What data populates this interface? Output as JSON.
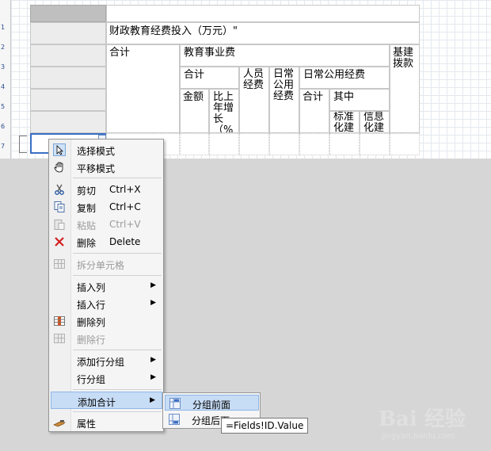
{
  "ruler": {
    "numbers": [
      "1",
      "2",
      "3",
      "4",
      "5",
      "6",
      "7"
    ]
  },
  "table": {
    "title": "财政教育经费投入（万元）\"",
    "col_total": "合计",
    "edu_business": "教育事业费",
    "sub_total": "合计",
    "staff_funds": "人员经费",
    "daily_public": "日常公用经费",
    "daily_public_funds": "日常公用经费",
    "capital": "基建拨款",
    "amount": "金额",
    "growth": "比上年增长（%",
    "dp_total": "合计",
    "among": "其中",
    "standardize": "标准化建",
    "info": "信息化建"
  },
  "context_menu": {
    "items": [
      {
        "icon": "pointer-icon",
        "label": "选择模式",
        "shortcut": "",
        "enabled": true
      },
      {
        "icon": "hand-icon",
        "label": "平移模式",
        "shortcut": "",
        "enabled": true
      },
      {
        "icon": "scissors-icon",
        "label": "剪切",
        "shortcut": "Ctrl+X",
        "enabled": true
      },
      {
        "icon": "copy-icon",
        "label": "复制",
        "shortcut": "Ctrl+C",
        "enabled": true
      },
      {
        "icon": "paste-icon",
        "label": "粘贴",
        "shortcut": "Ctrl+V",
        "enabled": false
      },
      {
        "icon": "delete-icon",
        "label": "删除",
        "shortcut": "Delete",
        "enabled": true
      },
      {
        "icon": "split-cells-icon",
        "label": "拆分单元格",
        "shortcut": "",
        "enabled": false
      },
      {
        "icon": "",
        "label": "插入列",
        "shortcut": "",
        "enabled": true,
        "submenu": true
      },
      {
        "icon": "",
        "label": "插入行",
        "shortcut": "",
        "enabled": true,
        "submenu": true
      },
      {
        "icon": "delete-column-icon",
        "label": "删除列",
        "shortcut": "",
        "enabled": true
      },
      {
        "icon": "delete-row-icon",
        "label": "删除行",
        "shortcut": "",
        "enabled": false
      },
      {
        "icon": "",
        "label": "添加行分组",
        "shortcut": "",
        "enabled": true,
        "submenu": true
      },
      {
        "icon": "",
        "label": "行分组",
        "shortcut": "",
        "enabled": true,
        "submenu": true
      },
      {
        "icon": "",
        "label": "添加合计",
        "shortcut": "",
        "enabled": true,
        "submenu": true,
        "highlighted": true
      },
      {
        "icon": "properties-icon",
        "label": "属性",
        "shortcut": "",
        "enabled": true
      }
    ]
  },
  "submenu": {
    "items": [
      {
        "icon": "group-before-icon",
        "label": "分组前面",
        "highlighted": true
      },
      {
        "icon": "group-after-icon",
        "label": "分组后面",
        "highlighted": false
      }
    ]
  },
  "tooltip": {
    "text": "=Fields!ID.Value"
  },
  "watermark": {
    "brand": "Bai 经验",
    "url": "jingyan.baidu.com"
  },
  "colors": {
    "highlight": "#c7dcf5",
    "selection_border": "#3a6fc4",
    "delete_red": "#d22020"
  }
}
